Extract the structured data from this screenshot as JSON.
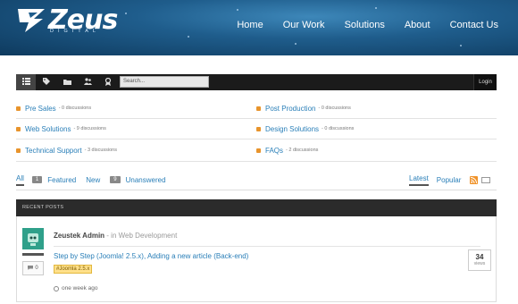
{
  "header": {
    "logo_word": "Zeus",
    "logo_sub": "DIGITAL",
    "nav": [
      "Home",
      "Our Work",
      "Solutions",
      "About",
      "Contact Us"
    ]
  },
  "toolbar": {
    "icons": [
      "list-icon",
      "tag-icon",
      "folder-icon",
      "users-icon",
      "badge-icon"
    ],
    "search_placeholder": "Search...",
    "login_label": "Login"
  },
  "categories": [
    {
      "label": "Pre Sales",
      "count": " - 0 discussions"
    },
    {
      "label": "Post Production",
      "count": " - 0 discussions"
    },
    {
      "label": "Web Solutions",
      "count": " - 9 discussions"
    },
    {
      "label": "Design Solutions",
      "count": " - 0 discussions"
    },
    {
      "label": "Technical Support",
      "count": " - 3 discussions"
    },
    {
      "label": "FAQs",
      "count": " - 2 discussions"
    }
  ],
  "filters": {
    "all": "All",
    "featured_badge": "1",
    "featured": "Featured",
    "new": "New",
    "unanswered_badge": "9",
    "unanswered": "Unanswered",
    "latest": "Latest",
    "popular": "Popular"
  },
  "recent_posts": {
    "heading": "RECENT POSTS",
    "post": {
      "author": "Zeustek Admin",
      "in_prefix": "- in",
      "category": "Web Development",
      "title": "Step by Step (Joomla! 2.5.x), Adding a new article (Back-end)",
      "tag": "#Joomla 2.5.x",
      "replies": "0",
      "views_count": "34",
      "views_label": "views",
      "time": "one week ago"
    }
  },
  "colors": {
    "link": "#2a7fb8",
    "accent_orange": "#e8942c",
    "toolbar_bg": "#1b1b1b",
    "header_blue": "#1f5d8c"
  }
}
